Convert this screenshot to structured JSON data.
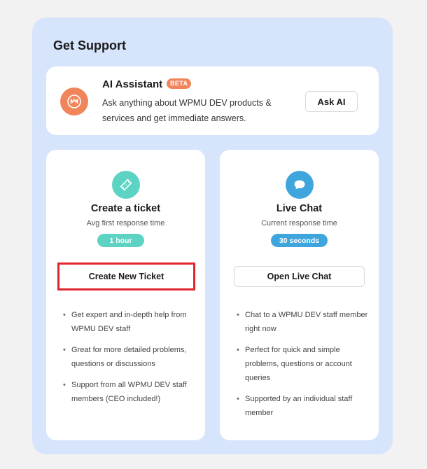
{
  "panel": {
    "title": "Get Support"
  },
  "ai_assistant": {
    "title": "AI Assistant",
    "badge": "BETA",
    "description": "Ask anything about WPMU DEV products & services and get immediate answers.",
    "button_label": "Ask AI",
    "logo_icon": "wpmu-dev-logo-icon",
    "logo_color": "#f0855c"
  },
  "ticket": {
    "icon": "ticket-icon",
    "icon_color": "#5dd3c4",
    "title": "Create a ticket",
    "subtitle": "Avg first response time",
    "response_time": "1 hour",
    "button_label": "Create New Ticket",
    "highlight_color": "#e0252d",
    "bullets": [
      "Get expert and in-depth help from WPMU DEV staff",
      "Great for more detailed problems, questions or discussions",
      "Support from all WPMU DEV staff members (CEO included!)"
    ]
  },
  "chat": {
    "icon": "chat-bubble-icon",
    "icon_color": "#3ea6dd",
    "title": "Live Chat",
    "subtitle": "Current response time",
    "response_time": "30 seconds",
    "button_label": "Open Live Chat",
    "bullets": [
      "Chat to a WPMU DEV staff member right now",
      "Perfect for quick and simple problems, questions or account queries",
      "Supported by an individual staff member"
    ]
  }
}
